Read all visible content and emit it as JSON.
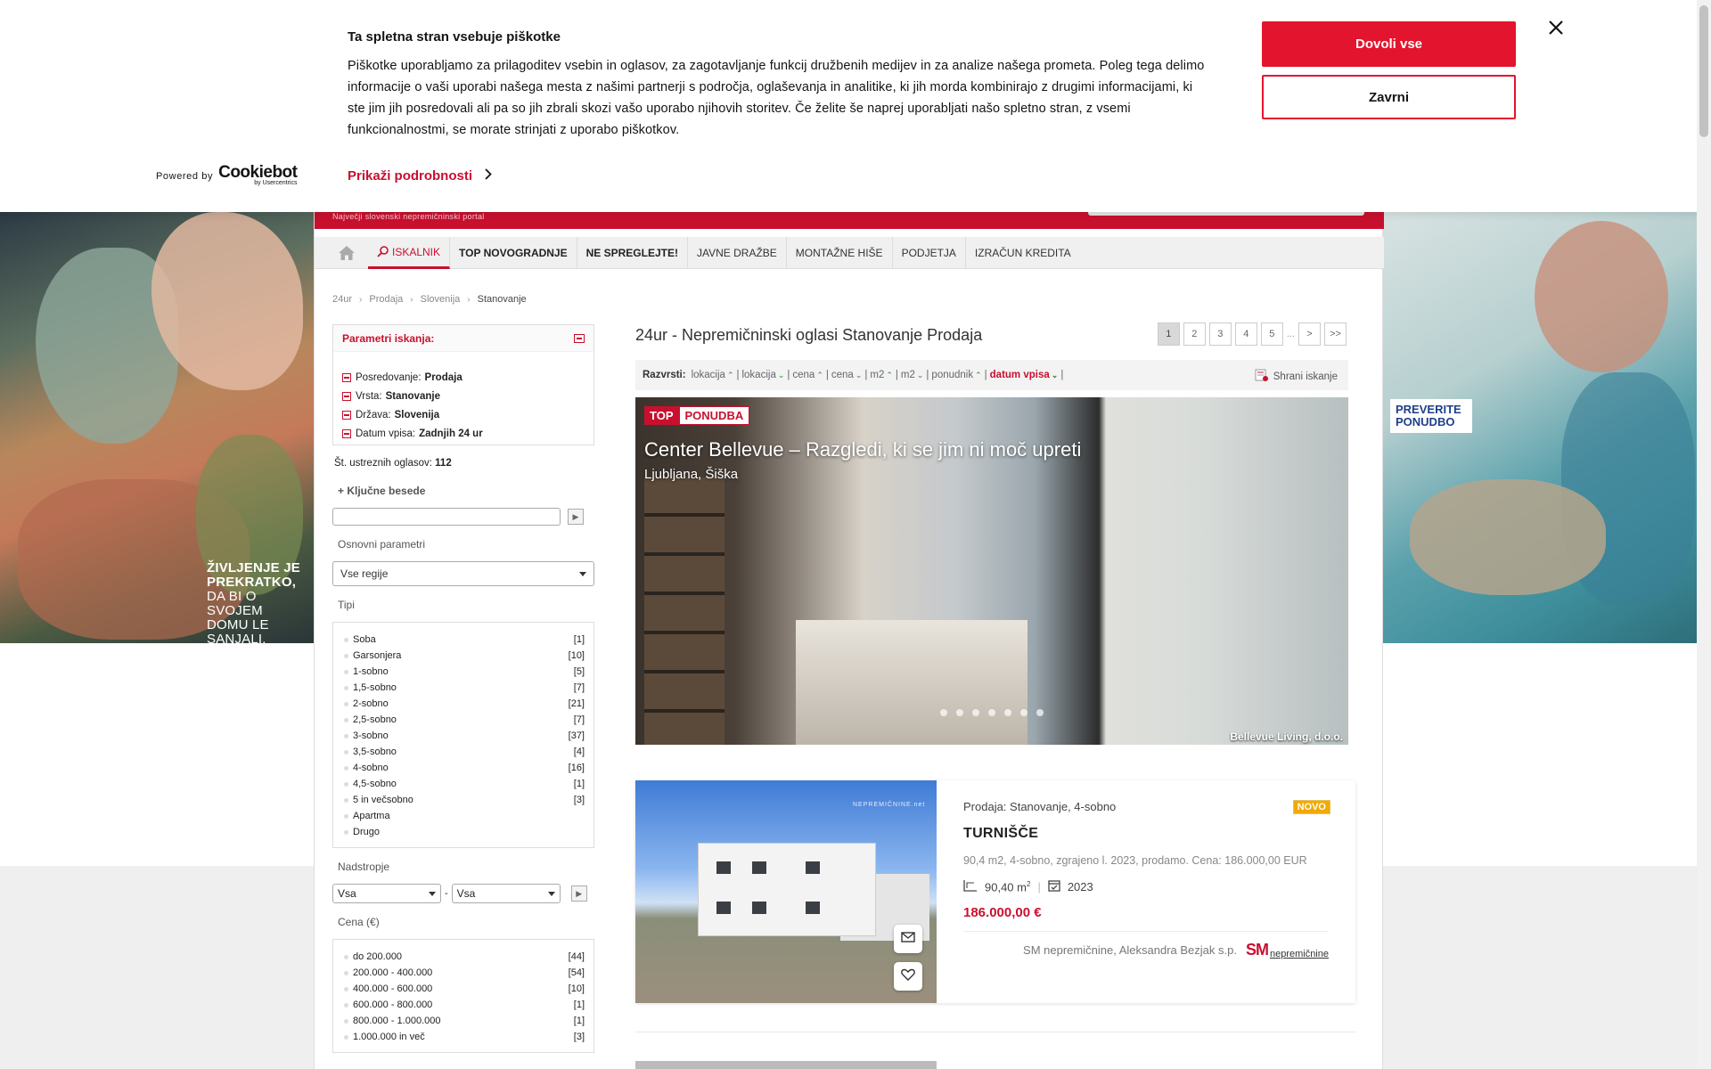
{
  "header": {
    "tagline": "Največji slovenski nepremičninski portal"
  },
  "nav": {
    "items": [
      {
        "label": "ISKALNIK"
      },
      {
        "label": "TOP NOVOGRADNJE"
      },
      {
        "label": "NE SPREGLEJTE!"
      },
      {
        "label": "JAVNE DRAŽBE"
      },
      {
        "label": "MONTAŽNE HIŠE"
      },
      {
        "label": "PODJETJA"
      },
      {
        "label": "IZRAČUN KREDITA"
      }
    ]
  },
  "breadcrumb": [
    "24ur",
    "Prodaja",
    "Slovenija",
    "Stanovanje"
  ],
  "sidebar": {
    "params_title": "Parametri iskanja:",
    "params": [
      {
        "key": "Posredovanje:",
        "value": "Prodaja"
      },
      {
        "key": "Vrsta:",
        "value": "Stanovanje"
      },
      {
        "key": "Država:",
        "value": "Slovenija"
      },
      {
        "key": "Datum vpisa:",
        "value": "Zadnjih 24 ur"
      }
    ],
    "match_label": "Št. ustreznih oglasov:",
    "match_count": "112",
    "keywords_toggle": "+ Ključne besede",
    "basic_params": "Osnovni parametri",
    "region_select": "Vse regije",
    "types_title": "Tipi",
    "types": [
      {
        "name": "Soba",
        "count": "[1]"
      },
      {
        "name": "Garsonjera",
        "count": "[10]"
      },
      {
        "name": "1-sobno",
        "count": "[5]"
      },
      {
        "name": "1,5-sobno",
        "count": "[7]"
      },
      {
        "name": "2-sobno",
        "count": "[21]"
      },
      {
        "name": "2,5-sobno",
        "count": "[7]"
      },
      {
        "name": "3-sobno",
        "count": "[37]"
      },
      {
        "name": "3,5-sobno",
        "count": "[4]"
      },
      {
        "name": "4-sobno",
        "count": "[16]"
      },
      {
        "name": "4,5-sobno",
        "count": "[1]"
      },
      {
        "name": "5 in večsobno",
        "count": "[3]"
      },
      {
        "name": "Apartma",
        "count": ""
      },
      {
        "name": "Drugo",
        "count": ""
      }
    ],
    "floor_title": "Nadstropje",
    "floor_from": "Vsa",
    "floor_sep": "-",
    "floor_to": "Vsa",
    "price_title": "Cena (€)",
    "prices": [
      {
        "name": "do  200.000",
        "count": "[44]"
      },
      {
        "name": "200.000 - 400.000",
        "count": "[54]"
      },
      {
        "name": "400.000 - 600.000",
        "count": "[10]"
      },
      {
        "name": "600.000 - 800.000",
        "count": "[1]"
      },
      {
        "name": "800.000 - 1.000.000",
        "count": "[1]"
      },
      {
        "name": "1.000.000  in več",
        "count": "[3]"
      }
    ]
  },
  "results": {
    "title": "24ur - Nepremičninski oglasi Stanovanje Prodaja",
    "pages": [
      "1",
      "2",
      "3",
      "4",
      "5"
    ],
    "pages_dots": "...",
    "next": ">",
    "last": ">>",
    "sort_label": "Razvrsti:",
    "sorts": [
      {
        "label": "lokacija",
        "dir": "^"
      },
      {
        "label": "lokacija",
        "dir": "v"
      },
      {
        "label": "cena",
        "dir": "^"
      },
      {
        "label": "cena",
        "dir": "v"
      },
      {
        "label": "m2",
        "dir": "^"
      },
      {
        "label": "m2",
        "dir": "v"
      },
      {
        "label": "ponudnik",
        "dir": "^"
      },
      {
        "label": "datum vpisa",
        "dir": "v"
      }
    ],
    "save_search": "Shrani iskanje"
  },
  "top_offer": {
    "tag_top": "TOP",
    "tag_offer": "PONUDBA",
    "headline": "Center Bellevue – Razgledi, ki se jim ni moč upreti",
    "location": "Ljubljana, Šiška",
    "agent": "Bellevue Living, d.o.o."
  },
  "listing": {
    "kind": "Prodaja: Stanovanje, 4-sobno",
    "badge": "NOVO",
    "location": "TURNIŠČE",
    "description": "90,4 m2, 4-sobno, zgrajeno l. 2023, prodamo. Cena: 186.000,00 EUR",
    "area": "90,40 m",
    "area_sup": "2",
    "year": "2023",
    "price": "186.000,00 €",
    "agency": "SM nepremičnine, Aleksandra Bezjak s.p.",
    "logo_sm": "SM",
    "logo_text": "nepremičnine",
    "watermark": "NEPREMIČNINE.net"
  },
  "ads": {
    "left_line1": "ŽIVLJENJE JE",
    "left_line2": "PREKRATKO,",
    "left_line3": "DA BI O",
    "left_line4": "SVOJEM",
    "left_line5": "DOMU LE",
    "left_line6": "SANJALI.",
    "right_line1": "PREVERITE",
    "right_line2": "PONUDBO"
  },
  "cookie": {
    "title": "Ta spletna stran vsebuje piškotke",
    "body": "Piškotke uporabljamo za prilagoditev vsebin in oglasov, za zagotavljanje funkcij družbenih medijev in za analize našega prometa. Poleg tega delimo informacije o vaši uporabi našega mesta z našimi partnerji s področja, oglaševanja in analitike, ki jih morda kombinirajo z drugimi informacijami, ki ste jim jih posredovali ali pa so jih zbrali skozi vašo uporabo njihovih storitev. Če želite še naprej uporabljati našo spletno stran, z vsemi funkcionalnostmi, se morate strinjati z uporabo piškotkov.",
    "powered_by": "Powered by",
    "cookiebot": "Cookiebot",
    "usercentrics": "by Usercentrics",
    "details": "Prikaži podrobnosti",
    "allow_all": "Dovoli vse",
    "reject": "Zavrni"
  },
  "colors": {
    "brand_red": "#c8102e",
    "cookie_red": "#e3142d",
    "badge_orange": "#f2a900",
    "sort_arrow_green": "#2a8a2a"
  }
}
